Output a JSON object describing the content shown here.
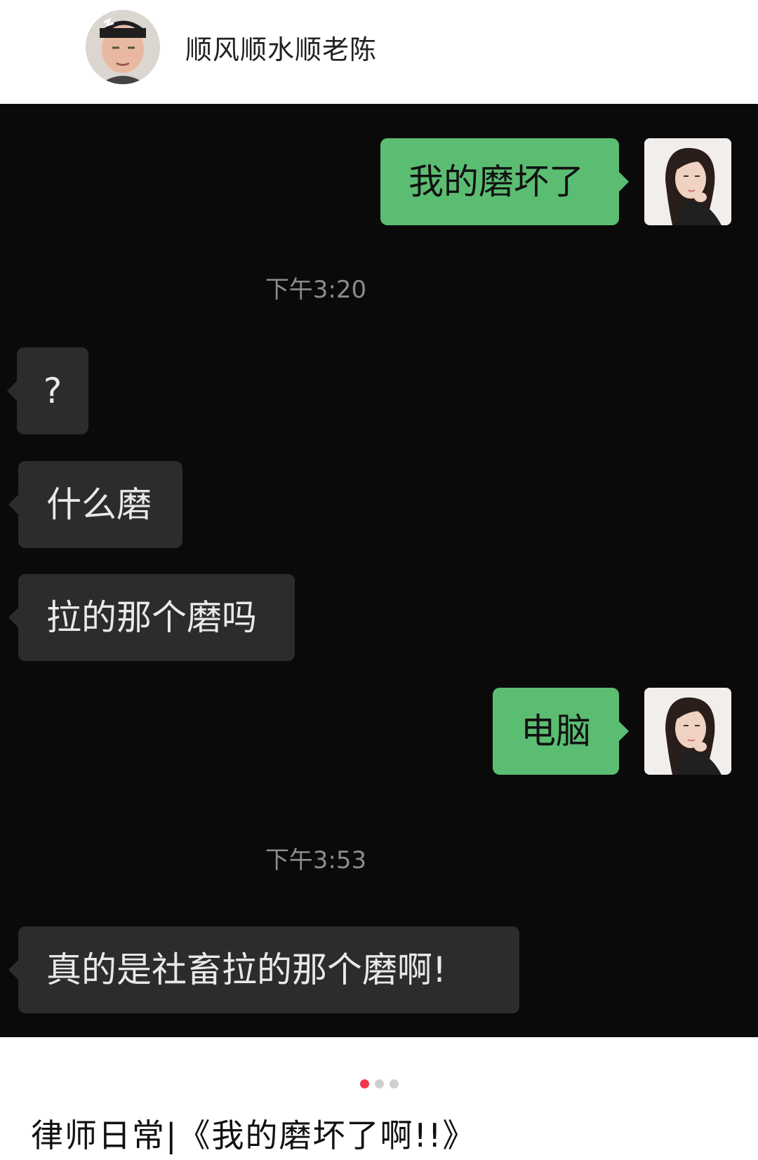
{
  "header": {
    "username": "顺风顺水顺老陈"
  },
  "messages": [
    {
      "side": "out",
      "text": "我的磨坏了"
    },
    {
      "timestamp": "下午3:20"
    },
    {
      "side": "in",
      "text": "?"
    },
    {
      "side": "in",
      "text": "什么磨"
    },
    {
      "side": "in",
      "text": "拉的那个磨吗"
    },
    {
      "side": "out",
      "text": "电脑"
    },
    {
      "timestamp": "下午3:53"
    },
    {
      "side": "in",
      "text": "真的是社畜拉的那个磨啊!"
    }
  ],
  "pager": {
    "total": 3,
    "active": 1
  },
  "caption": "律师日常|《我的磨坏了啊!!》",
  "colors": {
    "chat_bg": "#0a0a0a",
    "bubble_out": "#5bbd72",
    "bubble_in": "#2c2c2c",
    "dot_active": "#f2384e"
  }
}
